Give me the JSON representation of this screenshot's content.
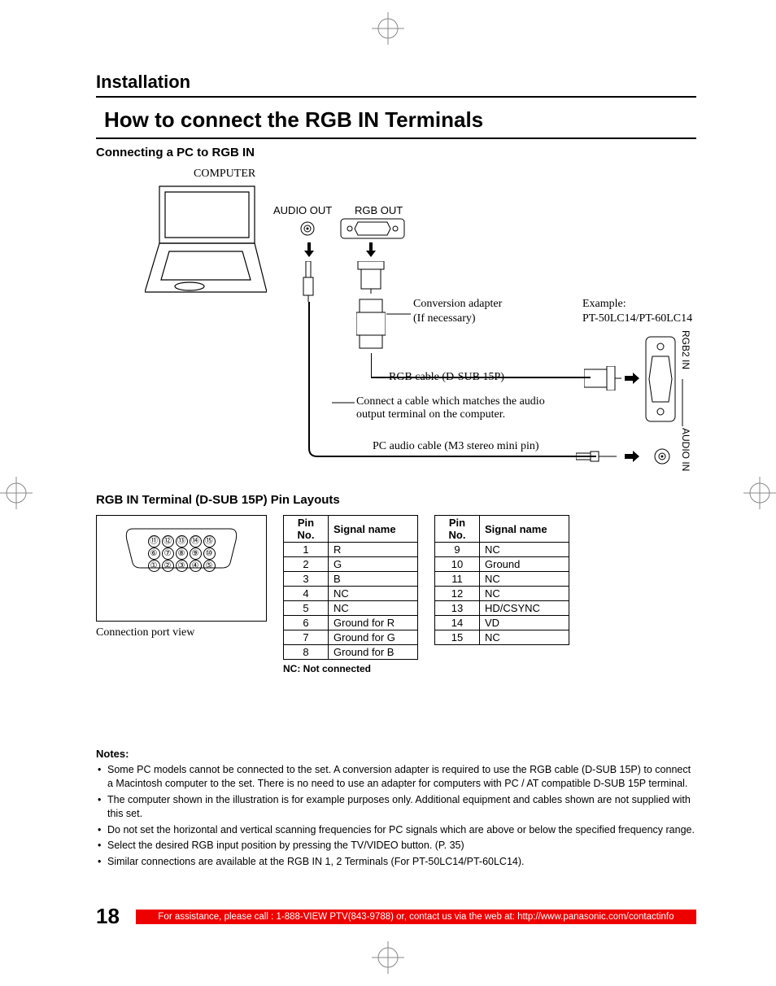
{
  "section_title": "Installation",
  "main_title": "How to connect the RGB IN Terminals",
  "sub1": "Connecting a PC to RGB IN",
  "diagram": {
    "computer": "COMPUTER",
    "audio_out": "AUDIO OUT",
    "rgb_out": "RGB OUT",
    "conv1": "Conversion adapter",
    "conv2": "(If necessary)",
    "example": "Example:",
    "model": "PT-50LC14/PT-60LC14",
    "rgb_cable": "RGB cable (D-SUB 15P)",
    "audio_note": "Connect a cable which matches the audio output terminal on the computer.",
    "pc_audio": "PC audio cable (M3 stereo mini pin)",
    "rgb2in": "RGB2 IN",
    "audioin": "AUDIO IN"
  },
  "sub2": "RGB IN Terminal (D-SUB 15P) Pin Layouts",
  "port_caption": "Connection port view",
  "pin_header1": "Pin No.",
  "pin_header2": "Signal name",
  "pins_left": [
    {
      "n": "1",
      "s": "R"
    },
    {
      "n": "2",
      "s": "G"
    },
    {
      "n": "3",
      "s": "B"
    },
    {
      "n": "4",
      "s": "NC"
    },
    {
      "n": "5",
      "s": "NC"
    },
    {
      "n": "6",
      "s": "Ground for R"
    },
    {
      "n": "7",
      "s": "Ground for G"
    },
    {
      "n": "8",
      "s": "Ground for B"
    }
  ],
  "pins_right": [
    {
      "n": "9",
      "s": "NC"
    },
    {
      "n": "10",
      "s": "Ground"
    },
    {
      "n": "11",
      "s": "NC"
    },
    {
      "n": "12",
      "s": "NC"
    },
    {
      "n": "13",
      "s": "HD/CSYNC"
    },
    {
      "n": "14",
      "s": "VD"
    },
    {
      "n": "15",
      "s": "NC"
    }
  ],
  "nc_note": "NC: Not connected",
  "notes_h": "Notes:",
  "notes": [
    "Some PC models cannot be connected to the set. A conversion adapter is required to use the RGB cable (D-SUB 15P) to connect a Macintosh computer to the set. There is no need to use an adapter for computers with PC / AT compatible D-SUB 15P terminal.",
    "The computer shown in the illustration is for example purposes only. Additional equipment and cables shown are not supplied with this set.",
    "Do not set the horizontal and vertical scanning frequencies for PC signals which are above or below the specified frequency range.",
    "Select the desired RGB input position by pressing the TV/VIDEO button. (P. 35)",
    "Similar connections are available at the RGB IN 1, 2 Terminals (For PT-50LC14/PT-60LC14)."
  ],
  "page_num": "18",
  "footer_bar": "For assistance, please call : 1-888-VIEW PTV(843-9788) or, contact us via the web at: http://www.panasonic.com/contactinfo"
}
